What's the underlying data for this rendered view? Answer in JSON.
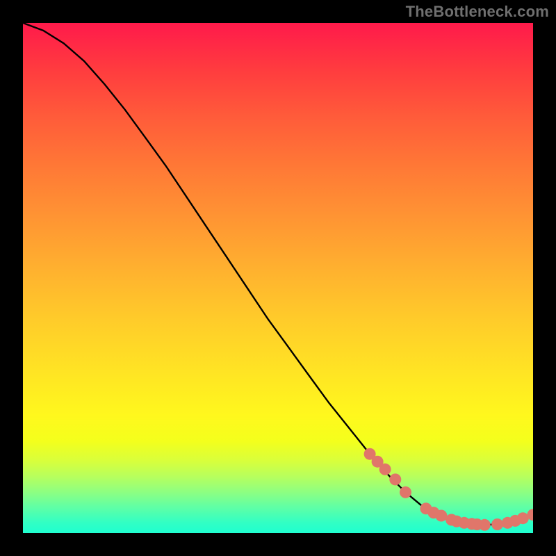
{
  "watermark": "TheBottleneck.com",
  "chart_data": {
    "type": "line",
    "title": "",
    "xlabel": "",
    "ylabel": "",
    "xlim": [
      0,
      100
    ],
    "ylim": [
      0,
      100
    ],
    "grid": false,
    "series": [
      {
        "name": "curve",
        "x": [
          0,
          4,
          8,
          12,
          16,
          20,
          24,
          28,
          32,
          36,
          40,
          44,
          48,
          52,
          56,
          60,
          64,
          68,
          72,
          75,
          78,
          81,
          84,
          87,
          90,
          93,
          96,
          100
        ],
        "y": [
          100,
          98.5,
          96,
          92.5,
          88,
          83,
          77.5,
          72,
          66,
          60,
          54,
          48,
          42,
          36.5,
          31,
          25.5,
          20.5,
          15.5,
          11,
          8,
          5.5,
          3.8,
          2.6,
          1.9,
          1.6,
          1.7,
          2.3,
          3.6
        ]
      }
    ],
    "points": {
      "name": "markers",
      "x": [
        68,
        69.5,
        71,
        73,
        75,
        79,
        80.5,
        82,
        84,
        85,
        86.5,
        88,
        89,
        90.5,
        93,
        95,
        96.5,
        98,
        100
      ],
      "y": [
        15.5,
        14,
        12.5,
        10.5,
        8.0,
        4.8,
        4.0,
        3.4,
        2.6,
        2.3,
        2.0,
        1.8,
        1.7,
        1.6,
        1.7,
        2.0,
        2.4,
        2.9,
        3.6
      ]
    },
    "marker_color": "#e0766a",
    "line_color": "#000000",
    "gradient_stops": [
      {
        "pos": 0,
        "color": "#ff1a4b"
      },
      {
        "pos": 50,
        "color": "#ffc62c"
      },
      {
        "pos": 82,
        "color": "#f4ff1c"
      },
      {
        "pos": 100,
        "color": "#1fffd0"
      }
    ]
  }
}
